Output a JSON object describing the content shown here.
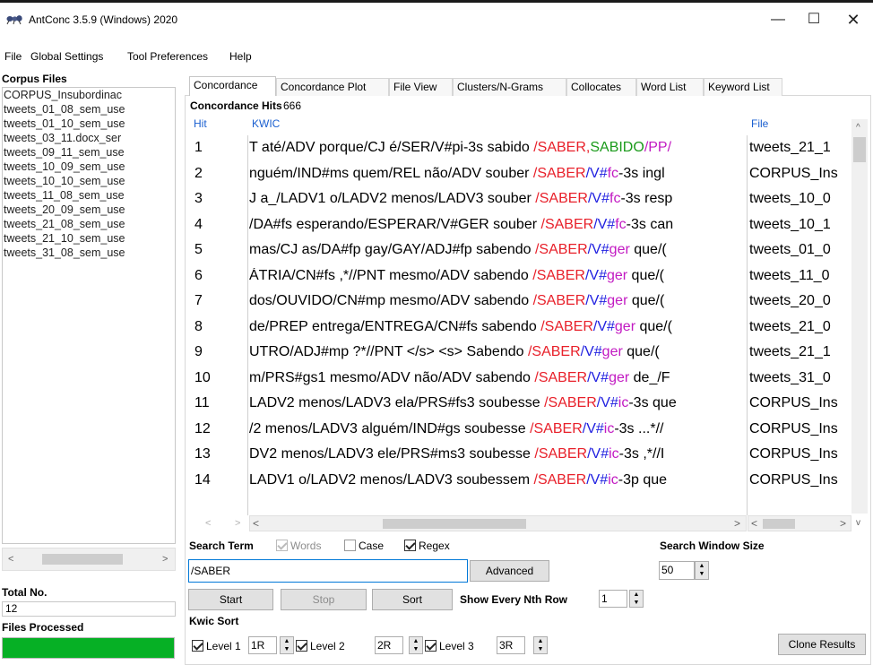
{
  "window": {
    "title": "AntConc 3.5.9 (Windows) 2020",
    "min_glyph": "—",
    "max_glyph": "☐",
    "close_glyph": "✕"
  },
  "menu": [
    "File",
    "Global Settings",
    "Tool Preferences",
    "Help"
  ],
  "left": {
    "corpus_files_label": "Corpus Files",
    "files": [
      "CORPUS_Insubordinac",
      "tweets_01_08_sem_use",
      "tweets_01_10_sem_use",
      "tweets_03_11.docx_ser",
      "tweets_09_11_sem_use",
      "tweets_10_09_sem_use",
      "tweets_10_10_sem_use",
      "tweets_11_08_sem_use",
      "tweets_20_09_sem_use",
      "tweets_21_08_sem_use",
      "tweets_21_10_sem_use",
      "tweets_31_08_sem_use"
    ],
    "total_no_label": "Total No.",
    "total_no_value": "12",
    "files_processed_label": "Files Processed",
    "files_processed_progress": 1.0
  },
  "tabs": [
    "Concordance",
    "Concordance Plot",
    "File View",
    "Clusters/N-Grams",
    "Collocates",
    "Word List",
    "Keyword List"
  ],
  "concordance": {
    "hits_label": "Concordance Hits",
    "hits_count": "666",
    "col_hit": "Hit",
    "col_kwic": "KWIC",
    "col_file": "File",
    "rows": [
      {
        "hit": "1",
        "pre": "T até/ADV porque/CJ é/SER/V#pi-3s sabido ",
        "kw": "/SABER",
        "tag": [
          ",",
          "SABIDO",
          "/PP/"
        ],
        "tagc": [
          "red",
          "green",
          "magenta"
        ],
        "post": "",
        "file": "tweets_21_1"
      },
      {
        "hit": "2",
        "pre": "nguém/IND#ms quem/REL não/ADV souber ",
        "kw": "/SABER",
        "tag": [
          "/V#",
          "fc",
          "-3s ingl"
        ],
        "tagc": [
          "blue",
          "magenta",
          ""
        ],
        "post": "",
        "file": "CORPUS_Ins"
      },
      {
        "hit": "3",
        "pre": "J a_/LADV1 o/LADV2 menos/LADV3 souber ",
        "kw": "/SABER",
        "tag": [
          "/V#",
          "fc",
          "-3s resp"
        ],
        "tagc": [
          "blue",
          "magenta",
          ""
        ],
        "post": "",
        "file": "tweets_10_0"
      },
      {
        "hit": "4",
        "pre": "/DA#fs esperando/ESPERAR/V#GER souber ",
        "kw": "/SABER",
        "tag": [
          "/V#",
          "fc",
          "-3s can"
        ],
        "tagc": [
          "blue",
          "magenta",
          ""
        ],
        "post": "",
        "file": "tweets_10_1"
      },
      {
        "hit": "5",
        "pre": "mas/CJ as/DA#fp gay/GAY/ADJ#fp sabendo ",
        "kw": "/SABER",
        "tag": [
          "/V#",
          "ger",
          " que/("
        ],
        "tagc": [
          "blue",
          "magenta",
          ""
        ],
        "post": "",
        "file": "tweets_01_0"
      },
      {
        "hit": "6",
        "pre": "ÁTRIA/CN#fs ,*//PNT mesmo/ADV sabendo ",
        "kw": "/SABER",
        "tag": [
          "/V#",
          "ger",
          " que/("
        ],
        "tagc": [
          "blue",
          "magenta",
          ""
        ],
        "post": "",
        "file": "tweets_11_0"
      },
      {
        "hit": "7",
        "pre": "dos/OUVIDO/CN#mp mesmo/ADV sabendo ",
        "kw": "/SABER",
        "tag": [
          "/V#",
          "ger",
          " que/("
        ],
        "tagc": [
          "blue",
          "magenta",
          ""
        ],
        "post": "",
        "file": "tweets_20_0"
      },
      {
        "hit": "8",
        "pre": "de/PREP entrega/ENTREGA/CN#fs sabendo ",
        "kw": "/SABER",
        "tag": [
          "/V#",
          "ger",
          " que/("
        ],
        "tagc": [
          "blue",
          "magenta",
          ""
        ],
        "post": "",
        "file": "tweets_21_0"
      },
      {
        "hit": "9",
        "pre": "UTRO/ADJ#mp ?*//PNT </s> <s> Sabendo ",
        "kw": "/SABER",
        "tag": [
          "/V#",
          "ger",
          " que/("
        ],
        "tagc": [
          "blue",
          "magenta",
          ""
        ],
        "post": "",
        "file": "tweets_21_1"
      },
      {
        "hit": "10",
        "pre": "m/PRS#gs1 mesmo/ADV não/ADV sabendo ",
        "kw": "/SABER",
        "tag": [
          "/V#",
          "ger",
          " de_/F"
        ],
        "tagc": [
          "blue",
          "magenta",
          ""
        ],
        "post": "",
        "file": "tweets_31_0"
      },
      {
        "hit": "11",
        "pre": "LADV2 menos/LADV3 ela/PRS#fs3 soubesse ",
        "kw": "/SABER",
        "tag": [
          "/V#",
          "ic",
          "-3s que"
        ],
        "tagc": [
          "blue",
          "magenta",
          ""
        ],
        "post": "",
        "file": "CORPUS_Ins"
      },
      {
        "hit": "12",
        "pre": "/2 menos/LADV3 alguém/IND#gs soubesse ",
        "kw": "/SABER",
        "tag": [
          "/V#",
          "ic",
          "-3s ...*//"
        ],
        "tagc": [
          "blue",
          "magenta",
          ""
        ],
        "post": "",
        "file": "CORPUS_Ins"
      },
      {
        "hit": "13",
        "pre": "DV2 menos/LADV3 ele/PRS#ms3 soubesse ",
        "kw": "/SABER",
        "tag": [
          "/V#",
          "ic",
          "-3s ,*//I"
        ],
        "tagc": [
          "blue",
          "magenta",
          ""
        ],
        "post": "",
        "file": "CORPUS_Ins"
      },
      {
        "hit": "14",
        "pre": "LADV1 o/LADV2 menos/LADV3 soubessem ",
        "kw": "/SABER",
        "tag": [
          "/V#",
          "ic",
          "-3p que"
        ],
        "tagc": [
          "blue",
          "magenta",
          ""
        ],
        "post": "",
        "file": "CORPUS_Ins"
      }
    ]
  },
  "search": {
    "search_term_label": "Search Term",
    "words_label": "Words",
    "case_label": "Case",
    "regex_label": "Regex",
    "words_checked": true,
    "case_checked": false,
    "regex_checked": true,
    "term_value": "/SABER",
    "advanced_label": "Advanced",
    "window_size_label": "Search Window Size",
    "window_size_value": "50",
    "start_label": "Start",
    "stop_label": "Stop",
    "sort_label": "Sort",
    "nth_row_label": "Show Every Nth Row",
    "nth_row_value": "1",
    "kwic_sort_label": "Kwic Sort",
    "level1_label": "Level 1",
    "level1_value": "1R",
    "level2_label": "Level 2",
    "level2_value": "2R",
    "level3_label": "Level 3",
    "level3_value": "3R",
    "clone_label": "Clone Results"
  },
  "colors": {
    "keyword": "#e8202a",
    "tag_blue": "#2020e0",
    "tag_green": "#1a9a1a",
    "tag_magenta": "#c21ac2",
    "progress": "#06b025",
    "header_blue": "#1a5fd0"
  }
}
